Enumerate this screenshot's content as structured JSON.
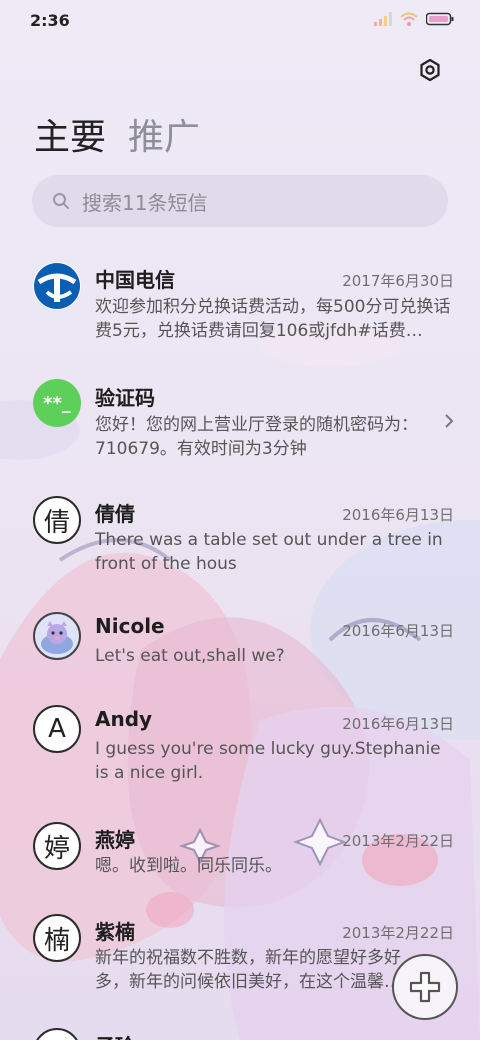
{
  "status_bar": {
    "time": "2:36",
    "icons": [
      "signal-icon",
      "wifi-icon",
      "battery-icon"
    ]
  },
  "header": {
    "tabs": [
      {
        "label": "主要",
        "active": true
      },
      {
        "label": "推广",
        "active": false
      }
    ],
    "settings_icon": "settings-icon"
  },
  "search": {
    "placeholder": "搜索11条短信",
    "icon": "search-icon"
  },
  "messages": [
    {
      "name": "中国电信",
      "date": "2017年6月30日",
      "snippet": "欢迎参加积分兑换话费活动，每500分可兑换话费5元，兑换话费请回复106或jfdh#话费…",
      "avatar": "china-telecom-logo"
    },
    {
      "name": "验证码",
      "date": "",
      "snippet": "您好！您的网上营业厅登录的随机密码为：710679。有效时间为3分钟",
      "avatar": "verification-code-icon",
      "avatar_text": "**_",
      "avatar_color": "#5dd05a"
    },
    {
      "name": "倩倩",
      "date": "2016年6月13日",
      "snippet": "There was a table set out under a tree in front of the hous",
      "avatar_text": "倩"
    },
    {
      "name": "Nicole",
      "date": "2016年6月13日",
      "snippet": "Let's eat out,shall we?",
      "avatar": "cartoon-photo-avatar"
    },
    {
      "name": "Andy",
      "date": "2016年6月13日",
      "snippet": "I guess you're some lucky guy.Stephanie is a nice girl.",
      "avatar_text": "A"
    },
    {
      "name": "燕婷",
      "date": "2013年2月22日",
      "snippet": "嗯。收到啦。同乐同乐。",
      "avatar_text": "婷"
    },
    {
      "name": "紫楠",
      "date": "2013年2月22日",
      "snippet": "新年的祝福数不胜数，新年的愿望好多好多，新年的问候依旧美好，在这个温馨的时刻",
      "avatar_text": "楠"
    },
    {
      "name": "子玲",
      "date": "",
      "snippet": "",
      "avatar_text": "玲"
    }
  ],
  "fab": {
    "icon": "plus-icon"
  }
}
